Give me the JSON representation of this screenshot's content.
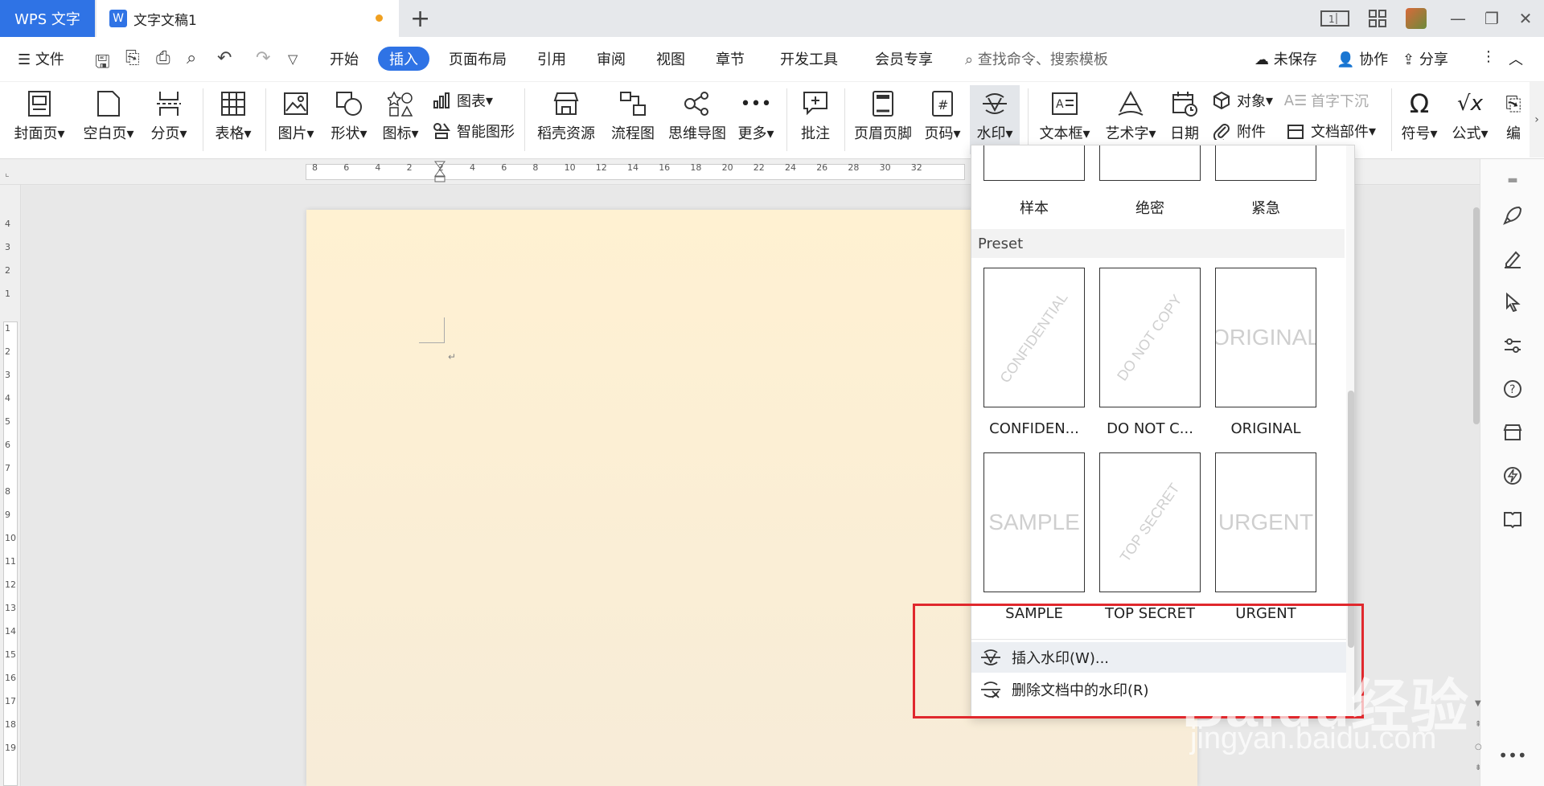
{
  "titlebar": {
    "app_tab": "WPS 文字",
    "doc_tab": "文字文稿1",
    "doc_icon": "W"
  },
  "menubar": {
    "file": "文件",
    "tabs": [
      "开始",
      "插入",
      "页面布局",
      "引用",
      "审阅",
      "视图",
      "章节",
      "开发工具",
      "会员专享"
    ],
    "active_tab": "插入",
    "search": "查找命令、搜索模板",
    "unsaved": "未保存",
    "collab": "协作",
    "share": "分享"
  },
  "ribbon": {
    "cover": "封面页",
    "blank": "空白页",
    "pagebreak": "分页",
    "table": "表格",
    "picture": "图片",
    "shape": "形状",
    "icon": "图标",
    "chart": "图表",
    "smartart": "智能图形",
    "resources": "稻壳资源",
    "flowchart": "流程图",
    "mindmap": "思维导图",
    "more": "更多",
    "comment": "批注",
    "headerfooter": "页眉页脚",
    "pagenum": "页码",
    "watermark": "水印",
    "textbox": "文本框",
    "wordart": "艺术字",
    "date": "日期",
    "object": "对象",
    "attachment": "附件",
    "dropcap": "首字下沉",
    "docparts": "文档部件",
    "symbol": "符号",
    "formula": "公式",
    "edit": "编"
  },
  "ruler": {
    "h_ticks": [
      "8",
      "6",
      "4",
      "2",
      "2",
      "4",
      "6",
      "8",
      "10",
      "12",
      "14",
      "16",
      "18",
      "20",
      "22",
      "24",
      "26",
      "28",
      "30",
      "32"
    ],
    "v_ticks": [
      "4",
      "3",
      "2",
      "1",
      "1",
      "2",
      "3",
      "4",
      "5",
      "6",
      "7",
      "8",
      "9",
      "10",
      "11",
      "12",
      "13",
      "14",
      "15",
      "16",
      "17",
      "18",
      "19"
    ]
  },
  "document": {
    "paragraph_mark": "↵"
  },
  "watermark_dropdown": {
    "top_row": [
      "样本",
      "绝密",
      "紧急"
    ],
    "section_title": "Preset",
    "preset_row1": [
      {
        "text": "CONFIDENTIAL",
        "label": "CONFIDEN..."
      },
      {
        "text": "DO NOT COPY",
        "label": "DO NOT C..."
      },
      {
        "text": "ORIGINAL",
        "label": "ORIGINAL"
      }
    ],
    "preset_row2": [
      {
        "text": "SAMPLE",
        "label": "SAMPLE"
      },
      {
        "text": "TOP SECRET",
        "label": "TOP SECRET"
      },
      {
        "text": "URGENT",
        "label": "URGENT"
      }
    ],
    "insert": "插入水印(W)...",
    "remove": "删除文档中的水印(R)"
  },
  "overlay": {
    "brand": "Baidu经验",
    "url": "jingyan.baidu.com"
  },
  "colors": {
    "accent": "#2f73e5",
    "highlight_box": "#e0282d",
    "page": "#fff1d2"
  }
}
